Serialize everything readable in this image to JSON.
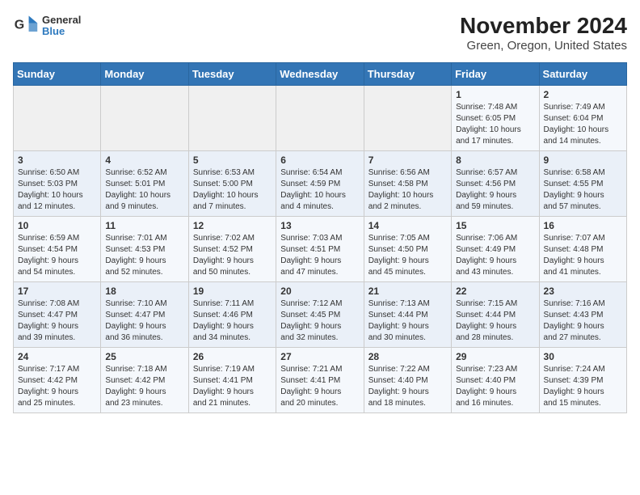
{
  "header": {
    "logo": {
      "line1": "General",
      "line2": "Blue"
    },
    "title": "November 2024",
    "subtitle": "Green, Oregon, United States"
  },
  "calendar": {
    "weekdays": [
      "Sunday",
      "Monday",
      "Tuesday",
      "Wednesday",
      "Thursday",
      "Friday",
      "Saturday"
    ],
    "weeks": [
      [
        {
          "day": "",
          "info": ""
        },
        {
          "day": "",
          "info": ""
        },
        {
          "day": "",
          "info": ""
        },
        {
          "day": "",
          "info": ""
        },
        {
          "day": "",
          "info": ""
        },
        {
          "day": "1",
          "info": "Sunrise: 7:48 AM\nSunset: 6:05 PM\nDaylight: 10 hours\nand 17 minutes."
        },
        {
          "day": "2",
          "info": "Sunrise: 7:49 AM\nSunset: 6:04 PM\nDaylight: 10 hours\nand 14 minutes."
        }
      ],
      [
        {
          "day": "3",
          "info": "Sunrise: 6:50 AM\nSunset: 5:03 PM\nDaylight: 10 hours\nand 12 minutes."
        },
        {
          "day": "4",
          "info": "Sunrise: 6:52 AM\nSunset: 5:01 PM\nDaylight: 10 hours\nand 9 minutes."
        },
        {
          "day": "5",
          "info": "Sunrise: 6:53 AM\nSunset: 5:00 PM\nDaylight: 10 hours\nand 7 minutes."
        },
        {
          "day": "6",
          "info": "Sunrise: 6:54 AM\nSunset: 4:59 PM\nDaylight: 10 hours\nand 4 minutes."
        },
        {
          "day": "7",
          "info": "Sunrise: 6:56 AM\nSunset: 4:58 PM\nDaylight: 10 hours\nand 2 minutes."
        },
        {
          "day": "8",
          "info": "Sunrise: 6:57 AM\nSunset: 4:56 PM\nDaylight: 9 hours\nand 59 minutes."
        },
        {
          "day": "9",
          "info": "Sunrise: 6:58 AM\nSunset: 4:55 PM\nDaylight: 9 hours\nand 57 minutes."
        }
      ],
      [
        {
          "day": "10",
          "info": "Sunrise: 6:59 AM\nSunset: 4:54 PM\nDaylight: 9 hours\nand 54 minutes."
        },
        {
          "day": "11",
          "info": "Sunrise: 7:01 AM\nSunset: 4:53 PM\nDaylight: 9 hours\nand 52 minutes."
        },
        {
          "day": "12",
          "info": "Sunrise: 7:02 AM\nSunset: 4:52 PM\nDaylight: 9 hours\nand 50 minutes."
        },
        {
          "day": "13",
          "info": "Sunrise: 7:03 AM\nSunset: 4:51 PM\nDaylight: 9 hours\nand 47 minutes."
        },
        {
          "day": "14",
          "info": "Sunrise: 7:05 AM\nSunset: 4:50 PM\nDaylight: 9 hours\nand 45 minutes."
        },
        {
          "day": "15",
          "info": "Sunrise: 7:06 AM\nSunset: 4:49 PM\nDaylight: 9 hours\nand 43 minutes."
        },
        {
          "day": "16",
          "info": "Sunrise: 7:07 AM\nSunset: 4:48 PM\nDaylight: 9 hours\nand 41 minutes."
        }
      ],
      [
        {
          "day": "17",
          "info": "Sunrise: 7:08 AM\nSunset: 4:47 PM\nDaylight: 9 hours\nand 39 minutes."
        },
        {
          "day": "18",
          "info": "Sunrise: 7:10 AM\nSunset: 4:47 PM\nDaylight: 9 hours\nand 36 minutes."
        },
        {
          "day": "19",
          "info": "Sunrise: 7:11 AM\nSunset: 4:46 PM\nDaylight: 9 hours\nand 34 minutes."
        },
        {
          "day": "20",
          "info": "Sunrise: 7:12 AM\nSunset: 4:45 PM\nDaylight: 9 hours\nand 32 minutes."
        },
        {
          "day": "21",
          "info": "Sunrise: 7:13 AM\nSunset: 4:44 PM\nDaylight: 9 hours\nand 30 minutes."
        },
        {
          "day": "22",
          "info": "Sunrise: 7:15 AM\nSunset: 4:44 PM\nDaylight: 9 hours\nand 28 minutes."
        },
        {
          "day": "23",
          "info": "Sunrise: 7:16 AM\nSunset: 4:43 PM\nDaylight: 9 hours\nand 27 minutes."
        }
      ],
      [
        {
          "day": "24",
          "info": "Sunrise: 7:17 AM\nSunset: 4:42 PM\nDaylight: 9 hours\nand 25 minutes."
        },
        {
          "day": "25",
          "info": "Sunrise: 7:18 AM\nSunset: 4:42 PM\nDaylight: 9 hours\nand 23 minutes."
        },
        {
          "day": "26",
          "info": "Sunrise: 7:19 AM\nSunset: 4:41 PM\nDaylight: 9 hours\nand 21 minutes."
        },
        {
          "day": "27",
          "info": "Sunrise: 7:21 AM\nSunset: 4:41 PM\nDaylight: 9 hours\nand 20 minutes."
        },
        {
          "day": "28",
          "info": "Sunrise: 7:22 AM\nSunset: 4:40 PM\nDaylight: 9 hours\nand 18 minutes."
        },
        {
          "day": "29",
          "info": "Sunrise: 7:23 AM\nSunset: 4:40 PM\nDaylight: 9 hours\nand 16 minutes."
        },
        {
          "day": "30",
          "info": "Sunrise: 7:24 AM\nSunset: 4:39 PM\nDaylight: 9 hours\nand 15 minutes."
        }
      ]
    ]
  }
}
